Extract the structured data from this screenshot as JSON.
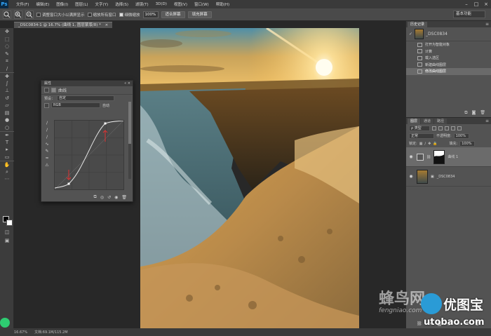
{
  "app": {
    "logo": "Ps"
  },
  "menu": [
    "文件(F)",
    "编辑(E)",
    "图像(I)",
    "图层(L)",
    "文字(Y)",
    "选择(S)",
    "滤镜(T)",
    "3D(D)",
    "视图(V)",
    "窗口(W)",
    "帮助(H)"
  ],
  "window_controls": [
    "–",
    "□",
    "×"
  ],
  "options_bar": {
    "check1": "调整窗口大小以满屏显示",
    "check2": "缩放所有窗口",
    "check3": "细微缩放",
    "zoom_value": "100%",
    "btn_fit_screen": "适合屏幕",
    "btn_fill_screen": "填充屏幕",
    "workspace": "基本功能"
  },
  "document_tab": {
    "title": "_DSC0834-1 @ 16.7% (曲线 1, 图层蒙版/8) *",
    "close": "×"
  },
  "status_bar": {
    "zoom": "16.67%",
    "doc_size": "文档:69.1M/115.2M"
  },
  "properties_panel": {
    "title": "属性",
    "header_label": "曲线",
    "preset_label": "预设：",
    "preset_value": "自定",
    "channel_value": "RGB",
    "auto_button": "自动"
  },
  "history_panel": {
    "tabs": [
      "历史记录"
    ],
    "snapshot_label": "_DSC0834",
    "items": [
      {
        "label": "打开为智能对象",
        "active": false
      },
      {
        "label": "计算",
        "active": false
      },
      {
        "label": "载入选区",
        "active": false
      },
      {
        "label": "新建曲线图层",
        "active": false
      },
      {
        "label": "修改曲线图层",
        "active": true
      }
    ]
  },
  "layers_panel": {
    "tabs": [
      "图层",
      "通道",
      "路径"
    ],
    "filter_label": "ρ 类型",
    "blend_mode": "正常",
    "opacity_label": "不透明度:",
    "opacity_value": "100%",
    "lock_label": "锁定:",
    "fill_label": "填充:",
    "fill_value": "100%",
    "layers": [
      {
        "name": "曲线 1",
        "active": true
      },
      {
        "name": "_DSC0834",
        "active": false
      }
    ]
  },
  "watermarks": {
    "fengniao": "蜂鸟网",
    "fengniao_sub": "fengniao.com",
    "brand": "优图宝",
    "url": "utobao.com"
  },
  "colors": {
    "foreground": "#000000",
    "background": "#ffffff",
    "accent": "#31a8ff"
  }
}
